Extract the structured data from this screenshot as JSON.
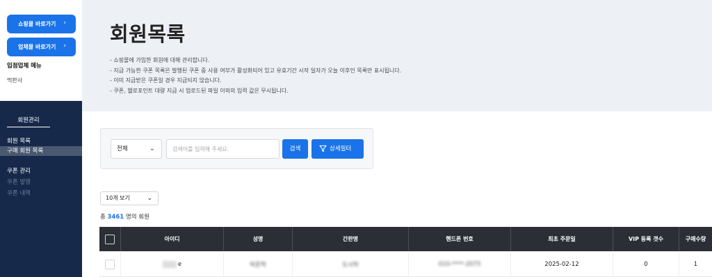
{
  "sidebar": {
    "shop_button": "쇼핑몰 바로가기",
    "vendor_button": "업체몰 바로가기",
    "chevron": "›",
    "vendor_menu_heading": "입점업체 메뉴",
    "vendor_name": "먹판사",
    "section_title": "회원관리",
    "items": [
      {
        "label": "회원 목록"
      },
      {
        "label": "구매 회원 목록"
      },
      {
        "label": "쿠폰 관리"
      },
      {
        "label": "쿠폰 발행"
      },
      {
        "label": "쿠폰 내역"
      }
    ]
  },
  "header": {
    "title": "회원목록",
    "descriptions": [
      "- 쇼핑몰에 가입한 회원에 대해 관리합니다.",
      "- 지급 가능한 쿠폰 목록은 발행된 쿠폰 중 사용 여부가 활성화되어 있고 유효기간 시작 일자가 오늘 이후인 목록만 표시됩니다.",
      "- 이미 지급받은 쿠폰일 경우 지급되지 않습니다.",
      "- 쿠폰, 헬로포인트 대량 지급 시 업로드된 파일 이외의 입력 값은 무시됩니다."
    ]
  },
  "search": {
    "category": "전체",
    "placeholder": "검색어를 입력해 주세요.",
    "search_button": "검색",
    "filter_button": "상세필터"
  },
  "list": {
    "per_page": "10개 보기",
    "count_prefix": "총",
    "count": "3461",
    "count_suffix": "명의 회원"
  },
  "table": {
    "columns": [
      "아이디",
      "성명",
      "간판명",
      "핸드폰 번호",
      "최초 주문일",
      "VIP 등록 갯수",
      "구매수량"
    ],
    "rows": [
      {
        "id": "e",
        "name": "박준혁",
        "shop": "도시락",
        "phone": "010-****-2075",
        "first_order": "2025-02-12",
        "vip_count": "0",
        "purchase_qty": "1"
      }
    ]
  },
  "colors": {
    "accent": "#1a73e8",
    "sidebar_bg": "#16294a",
    "header_bg": "#edf0f5",
    "table_head": "#2b2f35"
  },
  "icons": [
    "chevron-right-icon",
    "chevron-down-icon",
    "filter-icon",
    "checkbox-icon"
  ]
}
